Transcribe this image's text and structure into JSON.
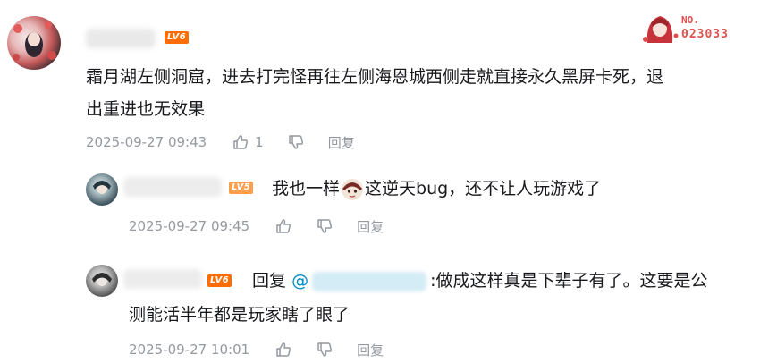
{
  "badge": {
    "prefix": "NO.",
    "number": "023033"
  },
  "main_comment": {
    "level": "LV6",
    "text_line1": "霜月湖左侧洞窟，进去打完怪再往左侧海恩城西侧走就直接永久黑屏卡死，退",
    "text_line2": "出重进也无效果",
    "time": "2025-09-27 09:43",
    "likes": "1",
    "reply_label": "回复"
  },
  "replies": [
    {
      "level": "LV5",
      "text_before": "我也一样",
      "text_after": "这逆天bug，还不让人玩游戏了",
      "time": "2025-09-27 09:45",
      "reply_label": "回复"
    },
    {
      "level": "LV6",
      "reply_prefix": "回复",
      "at": "@",
      "text_line1": ":做成这样真是下辈子有了。这要是公",
      "text_line2": "测能活半年都是玩家瞎了眼了",
      "time": "2025-09-27 10:01",
      "reply_label": "回复"
    }
  ],
  "colors": {
    "lv6": "#ff6c00",
    "lv5": "#ff9f4c",
    "meta": "#9499a0",
    "mention": "#008ac5"
  }
}
